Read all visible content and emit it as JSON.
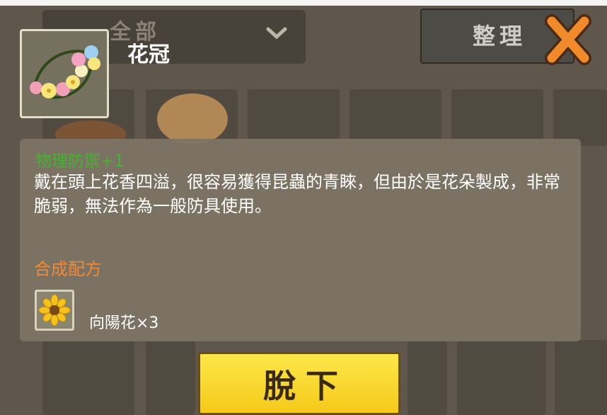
{
  "inventory": {
    "filter_label": "全部",
    "sort_label": "整理"
  },
  "item": {
    "name": "花冠",
    "icon": "flower-crown-icon",
    "stat": "物理防禦+1",
    "description": "戴在頭上花香四溢，很容易獲得昆蟲的青睞，但由於是花朵製成，非常脆弱，無法作為一般防具使用。",
    "recipe_title": "合成配方",
    "ingredient_icon": "sunflower-icon",
    "ingredient": "向陽花×3"
  },
  "actions": {
    "unequip_label": "脫下",
    "close_icon": "close-x-icon"
  },
  "colors": {
    "stat": "#43b52e",
    "recipe_title": "#f08a36",
    "button": "#f8d52a"
  }
}
